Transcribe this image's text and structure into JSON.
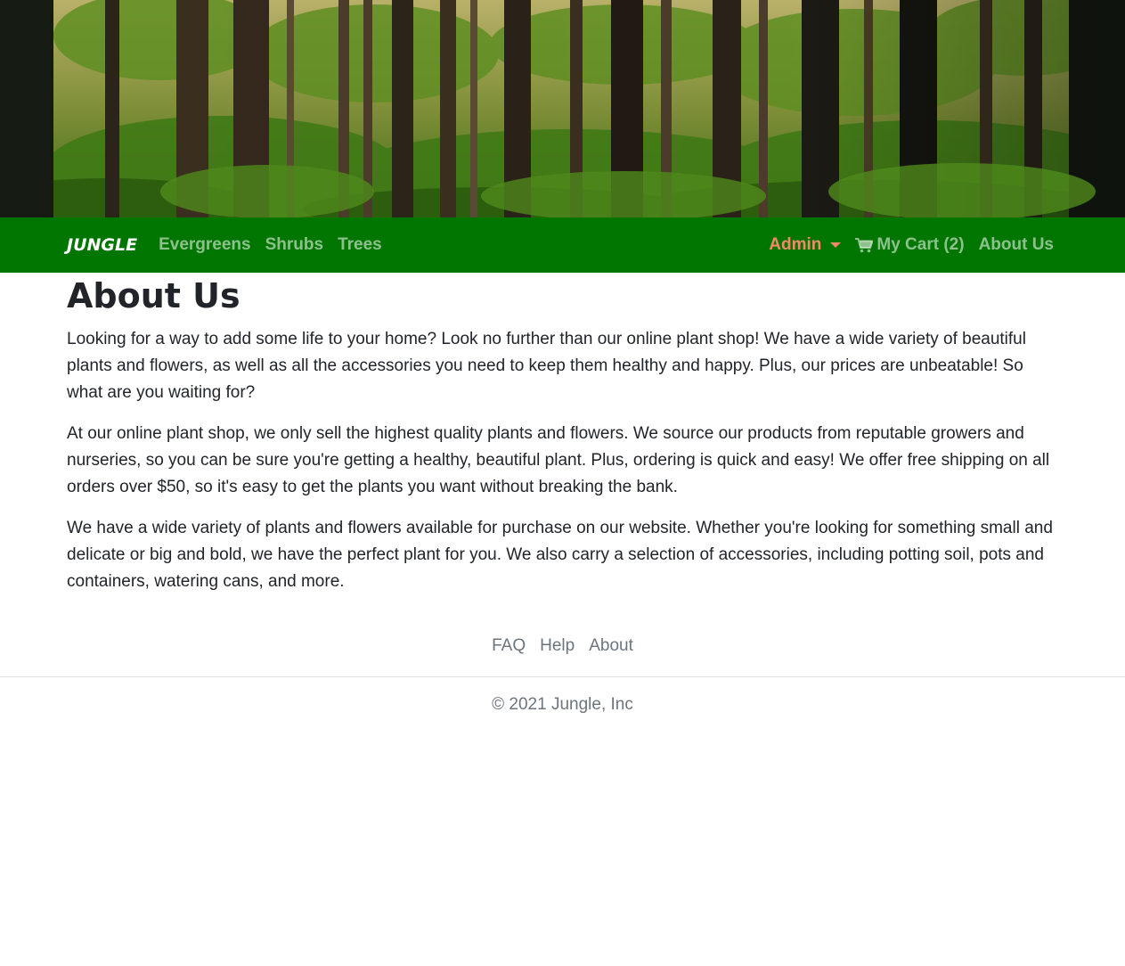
{
  "hero": {
    "image": "forest-banner"
  },
  "navbar": {
    "brand": "JUNGLE",
    "left_links": [
      {
        "label": "Evergreens"
      },
      {
        "label": "Shrubs"
      },
      {
        "label": "Trees"
      }
    ],
    "admin_label": "Admin",
    "cart_label": "My Cart (2)",
    "cart_icon": "shopping-cart-icon",
    "about_label": "About Us",
    "colors": {
      "background": "#007600",
      "link": "rgba(255,255,255,0.55)",
      "admin": "#f08a6c"
    }
  },
  "main": {
    "title": "About Us",
    "paragraphs": [
      "Looking for a way to add some life to your home? Look no further than our online plant shop! We have a wide variety of beautiful plants and flowers, as well as all the accessories you need to keep them healthy and happy. Plus, our prices are unbeatable! So what are you waiting for?",
      "At our online plant shop, we only sell the highest quality plants and flowers. We source our products from reputable growers and nurseries, so you can be sure you're getting a healthy, beautiful plant. Plus, ordering is quick and easy! We offer free shipping on all orders over $50, so it's easy to get the plants you want without breaking the bank.",
      "We have a wide variety of plants and flowers available for purchase on our website. Whether you're looking for something small and delicate or big and bold, we have the perfect plant for you. We also carry a selection of accessories, including potting soil, pots and containers, watering cans, and more."
    ]
  },
  "footer": {
    "links": [
      {
        "label": "FAQ"
      },
      {
        "label": "Help"
      },
      {
        "label": "About"
      }
    ],
    "copyright": "© 2021 Jungle, Inc"
  }
}
